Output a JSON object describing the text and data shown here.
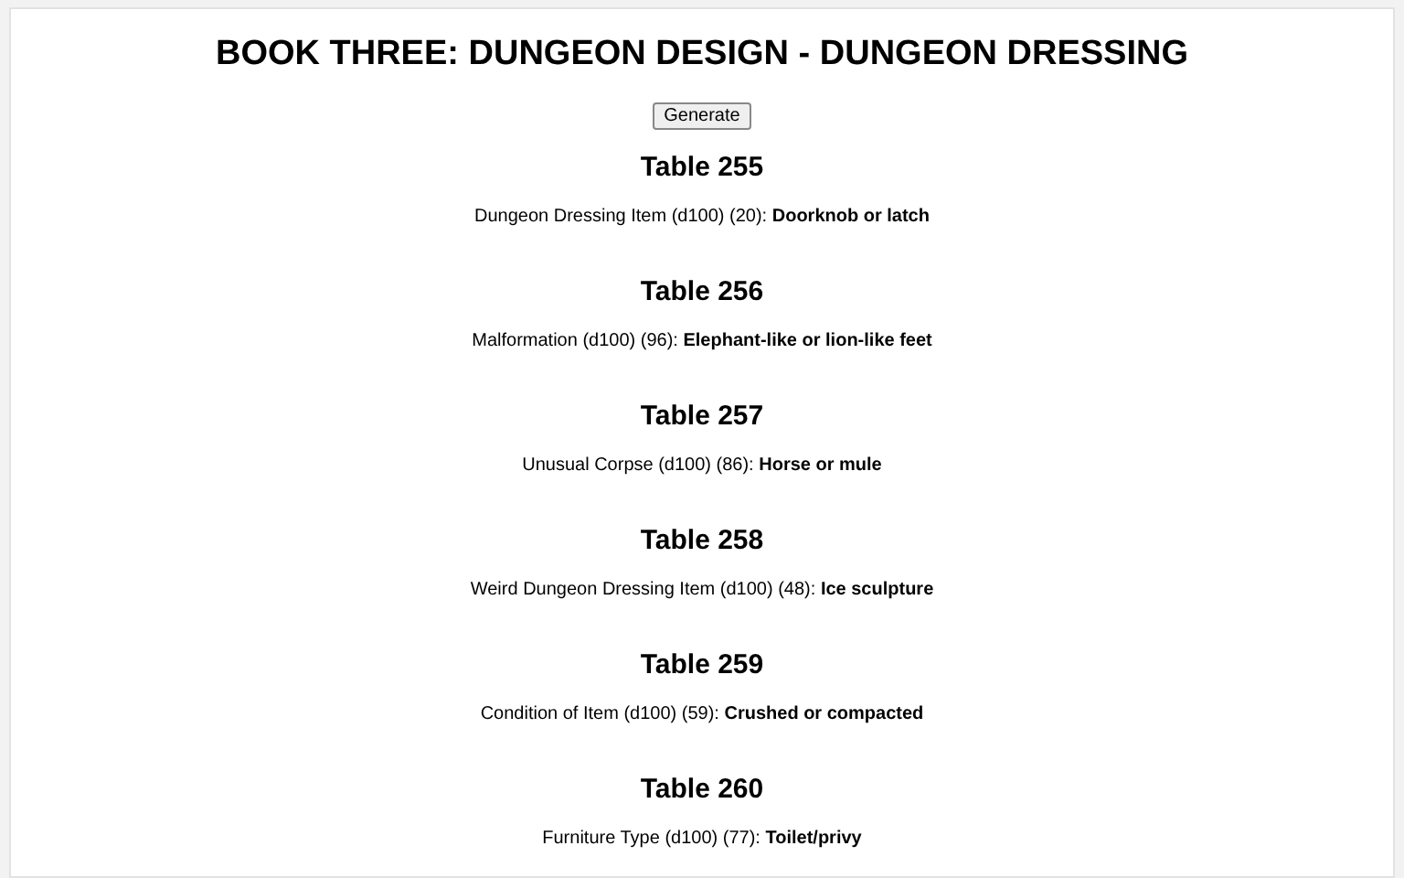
{
  "title": "BOOK THREE: DUNGEON DESIGN - DUNGEON DRESSING",
  "generate_button": "Generate",
  "tables": [
    {
      "heading": "Table 255",
      "result": "Dungeon Dressing Item (d100) (20): **Doorknob or latch**"
    },
    {
      "heading": "Table 256",
      "result": "Malformation (d100) (96): **Elephant-like or lion-like feet**"
    },
    {
      "heading": "Table 257",
      "result": "Unusual Corpse (d100) (86): **Horse or mule**"
    },
    {
      "heading": "Table 258",
      "result": "Weird Dungeon Dressing Item (d100) (48): **Ice sculpture**"
    },
    {
      "heading": "Table 259",
      "result": "Condition of Item (d100) (59): **Crushed or compacted**"
    },
    {
      "heading": "Table 260",
      "result": "Furniture Type (d100) (77): **Toilet/privy**"
    }
  ]
}
